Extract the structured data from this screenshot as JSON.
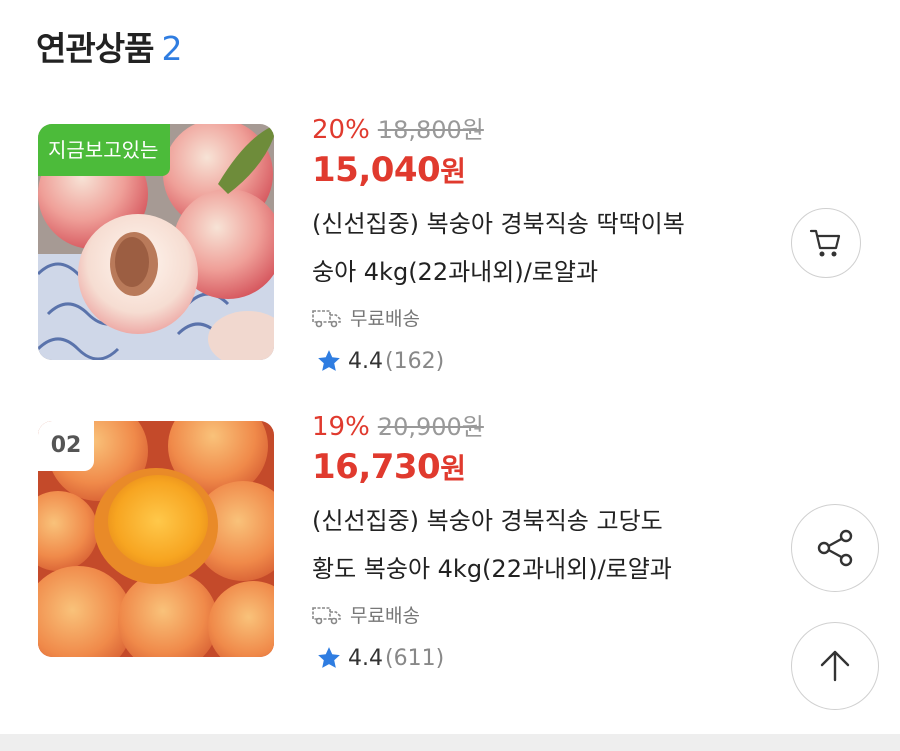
{
  "section": {
    "title": "연관상품",
    "count": "2"
  },
  "products": [
    {
      "badge": "지금보고있는",
      "discount": "20%",
      "original_price": "18,800원",
      "price": "15,040",
      "price_unit": "원",
      "name_line1": "(신선집중) 복숭아 경북직송 딱딱이복",
      "name_line2": "숭아 4kg(22과내외)/로얄과",
      "shipping": "무료배송",
      "rating": "4.4",
      "reviews": "(162)",
      "action_icon": "cart-icon"
    },
    {
      "badge": "02",
      "discount": "19%",
      "original_price": "20,900원",
      "price": "16,730",
      "price_unit": "원",
      "name_line1": "(신선집중) 복숭아 경북직송 고당도",
      "name_line2": "황도 복숭아 4kg(22과내외)/로얄과",
      "shipping": "무료배송",
      "rating": "4.4",
      "reviews": "(611)",
      "action_icon": "share-icon"
    }
  ],
  "floating": {
    "scroll_top_icon": "arrow-up-icon"
  },
  "colors": {
    "accent_red": "#e03a2e",
    "badge_green": "#4cbb3a",
    "star_blue": "#2f7de1",
    "count_blue": "#2f7de1"
  }
}
